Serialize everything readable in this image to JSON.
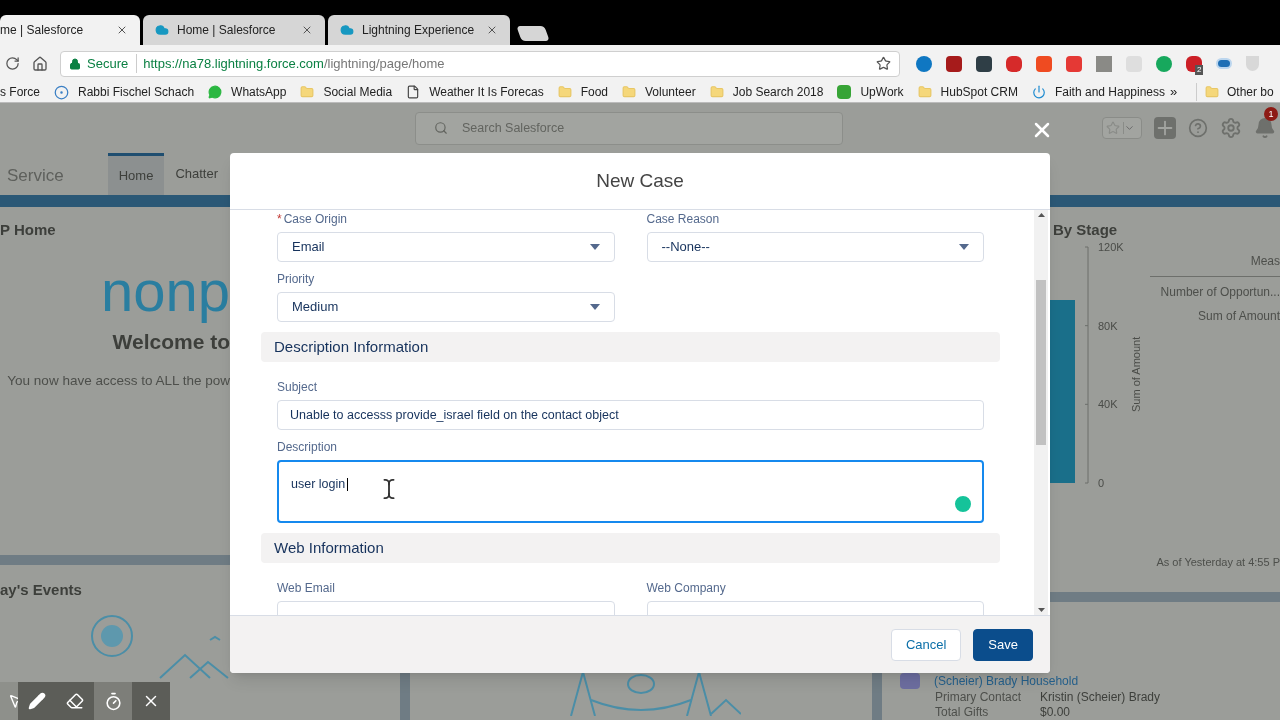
{
  "browser": {
    "tabs": [
      {
        "title": "me | Salesforce",
        "selected": true
      },
      {
        "title": "Home | Salesforce",
        "selected": false
      },
      {
        "title": "Lightning Experience",
        "selected": false
      }
    ],
    "address": {
      "secure_label": "Secure",
      "host": "https://na78.lightning.force.com",
      "path": "/lightning/page/home"
    },
    "extension_badge": "2",
    "bookmarks": [
      "s Force",
      "Rabbi Fischel Schach",
      "WhatsApp",
      "Social Media",
      "Weather It Is Forecas",
      "Food",
      "Volunteer",
      "Job Search 2018",
      "UpWork",
      "HubSpot CRM",
      "Faith and Happiness"
    ],
    "bookmarks_overflow": "»",
    "other_bookmarks": "Other bo"
  },
  "salesforce": {
    "search": {
      "placeholder": "Search Salesforce"
    },
    "notification_count": "1",
    "app_name": "Service",
    "nav_tabs": [
      {
        "label": "Home",
        "selected": true
      },
      {
        "label": "Chatter",
        "selected": false
      }
    ],
    "home_card": {
      "title": "P Home",
      "logo_text": "nonp",
      "welcome": "Welcome to",
      "body": "You now have access to ALL the pow"
    },
    "stage_card": {
      "title": "By Stage",
      "legend_heading": "Meas",
      "legend": [
        "Number of Opportun...",
        "Sum of Amount"
      ],
      "footer": "As of Yesterday at 4:55 P",
      "chart": {
        "axis_title": "Sum of Amount",
        "tick_labels": [
          "120K",
          "80K",
          "40K",
          "0"
        ]
      }
    },
    "events_card": {
      "title": "ay's Events"
    },
    "household_card": {
      "title": "(Scheier) Brady Household",
      "rows": [
        {
          "label": "Primary Contact",
          "value": "Kristin (Scheier) Brady"
        },
        {
          "label": "Total Gifts",
          "value": "$0.00"
        }
      ]
    }
  },
  "modal": {
    "title": "New Case",
    "items": [
      {
        "kind": "select",
        "label": "Case Origin",
        "required_mark": "*",
        "value": "Email"
      },
      {
        "kind": "select",
        "label": "Case Reason",
        "value": "--None--"
      },
      {
        "kind": "select",
        "label": "Priority",
        "value": "Medium"
      },
      {
        "kind": "section",
        "label": "Description Information"
      },
      {
        "kind": "input_wide",
        "label": "Subject",
        "value": "Unable to accesss provide_israel field on the contact object"
      },
      {
        "kind": "textarea",
        "label": "Description",
        "value": "user login",
        "focused": true
      },
      {
        "kind": "section",
        "label": "Web Information"
      },
      {
        "kind": "input",
        "label": "Web Email"
      },
      {
        "kind": "input",
        "label": "Web Company"
      }
    ],
    "buttons": [
      {
        "label": "Cancel",
        "kind": "neutral"
      },
      {
        "label": "Save",
        "kind": "brand"
      }
    ]
  }
}
